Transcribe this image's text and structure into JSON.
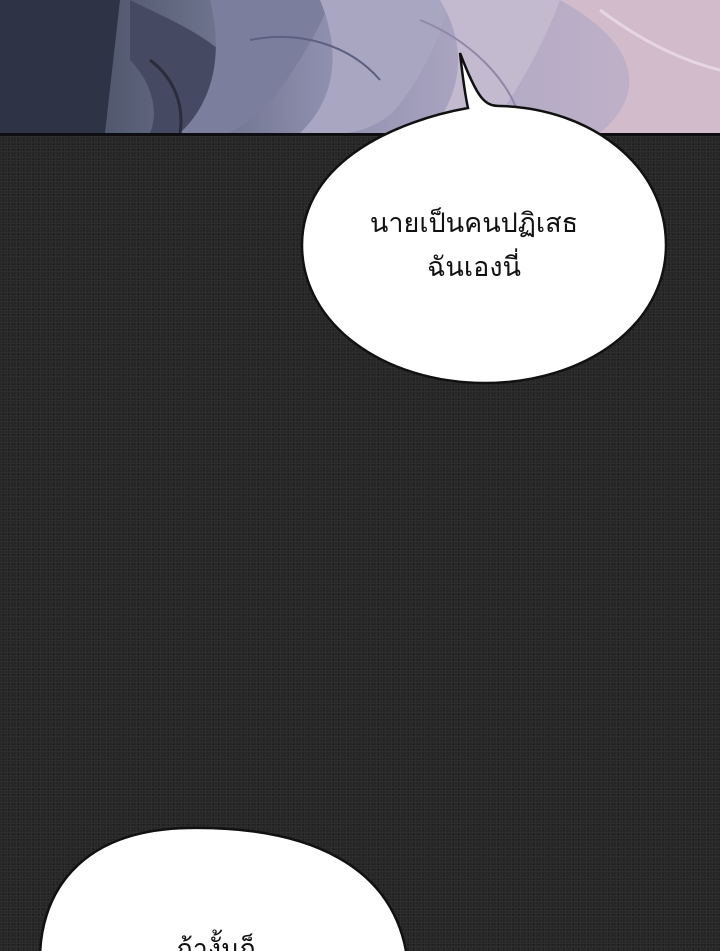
{
  "panels": {
    "top_panel": {
      "description_icon": "artwork-panel"
    }
  },
  "dialogue": {
    "bubble_1": {
      "line_1": "นายเป็นคนปฏิเสธ",
      "line_2": "ฉันเองนี่"
    },
    "bubble_2": {
      "line_1": "ถ้างั้นก็..."
    }
  },
  "colors": {
    "background": "#262626",
    "bubble_fill": "#ffffff",
    "bubble_stroke": "#111111",
    "text": "#111111"
  }
}
